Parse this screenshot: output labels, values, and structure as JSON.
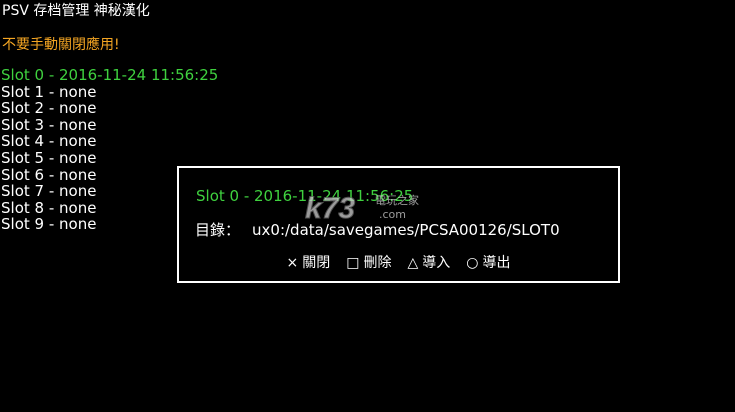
{
  "header": {
    "title": "PSV 存档管理  神秘漢化",
    "warning": "不要手動關閉應用!"
  },
  "slots": [
    {
      "label": "Slot 0 - 2016-11-24 11:56:25",
      "selected": true
    },
    {
      "label": "Slot 1 - none",
      "selected": false
    },
    {
      "label": "Slot 2 - none",
      "selected": false
    },
    {
      "label": "Slot 3 - none",
      "selected": false
    },
    {
      "label": "Slot 4 - none",
      "selected": false
    },
    {
      "label": "Slot 5 - none",
      "selected": false
    },
    {
      "label": "Slot 6 - none",
      "selected": false
    },
    {
      "label": "Slot 7 - none",
      "selected": false
    },
    {
      "label": "Slot 8 - none",
      "selected": false
    },
    {
      "label": "Slot 9 - none",
      "selected": false
    }
  ],
  "dialog": {
    "slot_title": "Slot 0 - 2016-11-24 11:56:25",
    "path_label": "目錄：",
    "path_value": "ux0:/data/savegames/PCSA00126/SLOT0",
    "actions": [
      {
        "icon": "cross-icon",
        "glyph": "×",
        "label": "關閉"
      },
      {
        "icon": "square-icon",
        "glyph": "□",
        "label": "刪除"
      },
      {
        "icon": "triangle-icon",
        "glyph": "△",
        "label": "導入"
      },
      {
        "icon": "circle-icon",
        "glyph": "○",
        "label": "導出"
      }
    ]
  },
  "watermark": {
    "logo": "k73",
    "site_cn": "電玩之家",
    "site_url": ".com"
  },
  "colors": {
    "background": "#000000",
    "text": "#ffffff",
    "selected": "#3fd13f",
    "warning": "#f5a623"
  }
}
